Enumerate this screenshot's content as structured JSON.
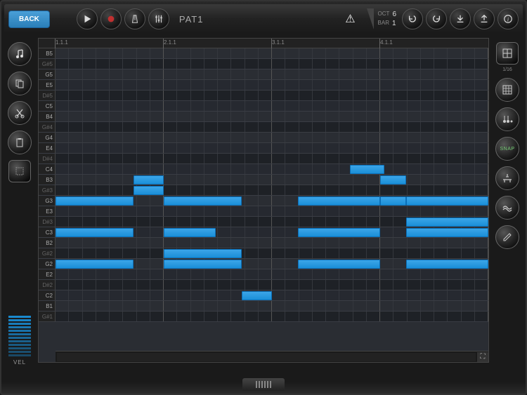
{
  "header": {
    "back_label": "BACK",
    "pattern_name": "PAT1",
    "oct_label": "OCT",
    "oct_value": "6",
    "bar_label": "BAR",
    "bar_value": "1"
  },
  "ruler": {
    "marks": [
      {
        "pos": 0,
        "label": "1.1.1"
      },
      {
        "pos": 25,
        "label": "2.1.1"
      },
      {
        "pos": 50,
        "label": "3.1.1"
      },
      {
        "pos": 75,
        "label": "4.1.1"
      }
    ]
  },
  "rows": [
    {
      "label": "B5",
      "sharp": false
    },
    {
      "label": "G#5",
      "sharp": true
    },
    {
      "label": "G5",
      "sharp": false
    },
    {
      "label": "E5",
      "sharp": false
    },
    {
      "label": "D#5",
      "sharp": true
    },
    {
      "label": "C5",
      "sharp": false
    },
    {
      "label": "B4",
      "sharp": false
    },
    {
      "label": "G#4",
      "sharp": true
    },
    {
      "label": "G4",
      "sharp": false
    },
    {
      "label": "E4",
      "sharp": false
    },
    {
      "label": "D#4",
      "sharp": true
    },
    {
      "label": "C4",
      "sharp": false
    },
    {
      "label": "B3",
      "sharp": false
    },
    {
      "label": "G#3",
      "sharp": true
    },
    {
      "label": "G3",
      "sharp": false
    },
    {
      "label": "E3",
      "sharp": false
    },
    {
      "label": "D#3",
      "sharp": true
    },
    {
      "label": "C3",
      "sharp": false
    },
    {
      "label": "B2",
      "sharp": false
    },
    {
      "label": "G#2",
      "sharp": true
    },
    {
      "label": "G2",
      "sharp": false
    },
    {
      "label": "E2",
      "sharp": false
    },
    {
      "label": "D#2",
      "sharp": true
    },
    {
      "label": "C2",
      "sharp": false
    },
    {
      "label": "B1",
      "sharp": false
    },
    {
      "label": "G#1",
      "sharp": true
    }
  ],
  "notes": [
    {
      "row": 11,
      "start": 68,
      "len": 8
    },
    {
      "row": 12,
      "start": 18,
      "len": 7
    },
    {
      "row": 12,
      "start": 75,
      "len": 6
    },
    {
      "row": 13,
      "start": 18,
      "len": 7
    },
    {
      "row": 14,
      "start": 0,
      "len": 18
    },
    {
      "row": 14,
      "start": 25,
      "len": 18
    },
    {
      "row": 14,
      "start": 56,
      "len": 19
    },
    {
      "row": 14,
      "start": 75,
      "len": 6
    },
    {
      "row": 14,
      "start": 81,
      "len": 19
    },
    {
      "row": 16,
      "start": 81,
      "len": 19
    },
    {
      "row": 17,
      "start": 0,
      "len": 18
    },
    {
      "row": 17,
      "start": 25,
      "len": 12
    },
    {
      "row": 17,
      "start": 56,
      "len": 19
    },
    {
      "row": 17,
      "start": 81,
      "len": 19
    },
    {
      "row": 19,
      "start": 25,
      "len": 18
    },
    {
      "row": 20,
      "start": 0,
      "len": 18
    },
    {
      "row": 20,
      "start": 25,
      "len": 18
    },
    {
      "row": 20,
      "start": 56,
      "len": 19
    },
    {
      "row": 20,
      "start": 81,
      "len": 19
    },
    {
      "row": 23,
      "start": 43,
      "len": 7
    }
  ],
  "right_sub_label": "1/16",
  "snap_label": "SNAP",
  "velocity": {
    "label": "VEL",
    "bars": 12
  },
  "colors": {
    "note": "#1a8fd8",
    "accent": "#3ba5e8"
  }
}
